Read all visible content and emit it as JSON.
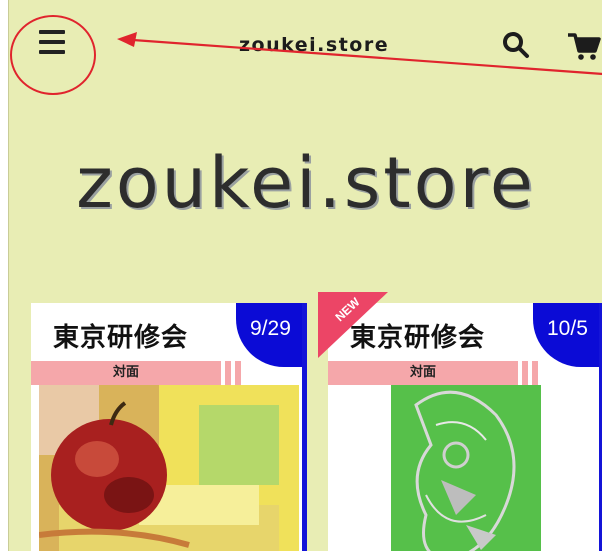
{
  "header": {
    "title": "zoukei.store"
  },
  "logo": {
    "text": "zoukei.store"
  },
  "cards": [
    {
      "title": "東京研修会",
      "date": "9/29",
      "label": "対面"
    },
    {
      "title": "東京研修会",
      "date": "10/5",
      "label": "対面",
      "ribbon": "NEW"
    }
  ],
  "colors": {
    "background": "#e8edb4",
    "accent_blue": "#0b0bd6",
    "pink": "#f5a7aa",
    "annotation_red": "#e0242d"
  },
  "icons": [
    "menu-icon",
    "search-icon",
    "cart-icon"
  ]
}
